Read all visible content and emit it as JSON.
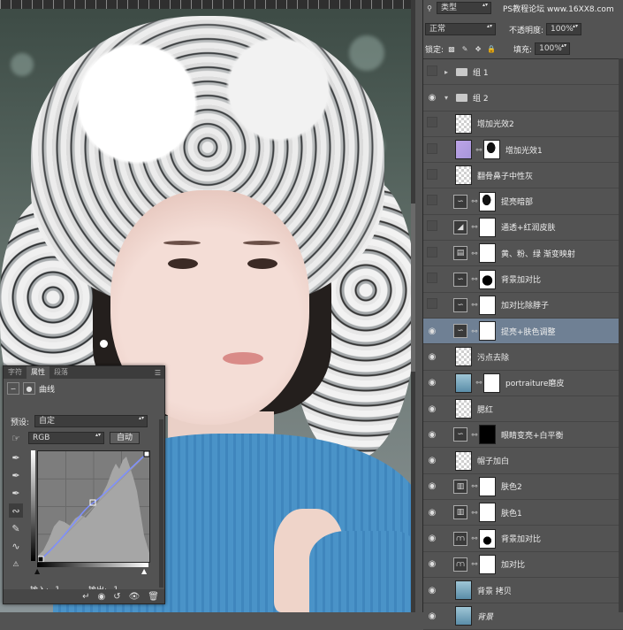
{
  "canvas": {
    "description_icon": "portrait-photo"
  },
  "properties_panel": {
    "tabs": [
      "字符",
      "属性",
      "段落"
    ],
    "active_tab": "属性",
    "adjustment_label": "曲线",
    "preset_label": "预设:",
    "preset_value": "自定",
    "channel_value": "RGB",
    "auto_button": "自动",
    "input_label": "输入:",
    "input_value": "-1",
    "output_label": "输出:",
    "output_value": "-1"
  },
  "layers_panel": {
    "kind_label": "类型",
    "watermark": "PS教程论坛 www.16XX8.com",
    "blend_mode": "正常",
    "opacity_label": "不透明度:",
    "opacity_value": "100%",
    "lock_label": "锁定:",
    "fill_label": "填充:",
    "fill_value": "100%",
    "layers": [
      {
        "name": "组 1",
        "type": "group-collapsed",
        "visible": false
      },
      {
        "name": "组 2",
        "type": "group-open",
        "visible": true
      },
      {
        "name": "增加光效2",
        "type": "pixel",
        "visible": false,
        "thumb": "checker"
      },
      {
        "name": "增加光效1",
        "type": "pixel-mask",
        "visible": false,
        "thumb": "purple",
        "mask": "maskblk2"
      },
      {
        "name": "翻骨鼻子中性灰",
        "type": "pixel",
        "visible": false,
        "thumb": "checker"
      },
      {
        "name": "提亮暗部",
        "type": "adjust-curves",
        "visible": false,
        "mask": "maskblk2"
      },
      {
        "name": "通透+红润皮肤",
        "type": "adjust-levels",
        "visible": false,
        "mask": "white"
      },
      {
        "name": "黄、粉、绿 渐变映射",
        "type": "adjust-gradient",
        "visible": false,
        "mask": "white"
      },
      {
        "name": "背景加对比",
        "type": "adjust-curves",
        "visible": false,
        "mask": "maskblk"
      },
      {
        "name": "加对比除脖子",
        "type": "adjust-curves",
        "visible": false,
        "mask": "white"
      },
      {
        "name": "提亮+肤色调整",
        "type": "adjust-curves",
        "visible": true,
        "mask": "white",
        "selected": true
      },
      {
        "name": "污点去除",
        "type": "pixel",
        "visible": true,
        "thumb": "checker"
      },
      {
        "name": "portraiture磨皮",
        "type": "pixel-mask",
        "visible": true,
        "thumb": "photo",
        "mask": "white"
      },
      {
        "name": "腮红",
        "type": "pixel",
        "visible": true,
        "thumb": "checker"
      },
      {
        "name": "眼睛变亮+白平衡",
        "type": "adjust-curves",
        "visible": true,
        "mask": "blk"
      },
      {
        "name": "帽子加白",
        "type": "pixel",
        "visible": true,
        "thumb": "checker"
      },
      {
        "name": "肤色2",
        "type": "adjust-channel",
        "visible": true,
        "mask": "white"
      },
      {
        "name": "肤色1",
        "type": "adjust-channel",
        "visible": true,
        "mask": "white"
      },
      {
        "name": "背景加对比",
        "type": "adjust-hist",
        "visible": true,
        "mask": "maskmid"
      },
      {
        "name": "加对比",
        "type": "adjust-hist",
        "visible": true,
        "mask": "white"
      },
      {
        "name": "背景 拷贝",
        "type": "pixel",
        "visible": true,
        "thumb": "photo"
      },
      {
        "name": "背景",
        "type": "pixel",
        "visible": true,
        "thumb": "photo"
      }
    ]
  },
  "colors": {
    "panel_bg": "#535353",
    "selected_layer": "#6f8094",
    "curve_line": "#7e8fff"
  }
}
